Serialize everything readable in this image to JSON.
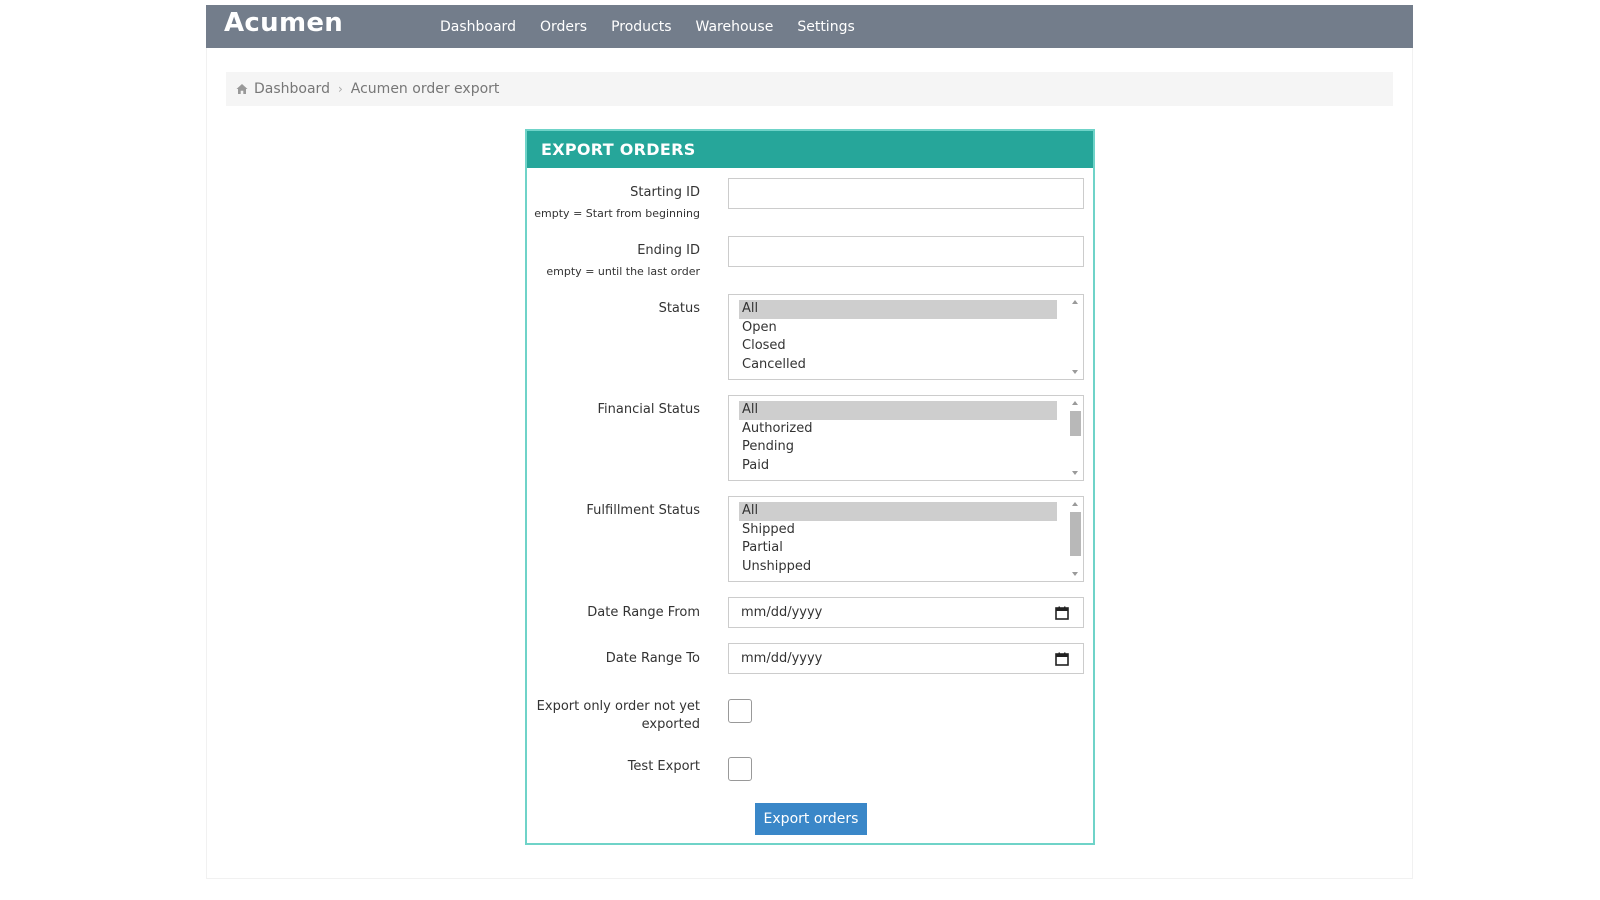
{
  "navbar": {
    "brand": "Acumen",
    "links": [
      {
        "label": "Dashboard"
      },
      {
        "label": "Orders"
      },
      {
        "label": "Products"
      },
      {
        "label": "Warehouse"
      },
      {
        "label": "Settings"
      }
    ]
  },
  "breadcrumb": {
    "home": "Dashboard",
    "current": "Acumen order export"
  },
  "form": {
    "title": "EXPORT ORDERS",
    "starting_id": {
      "label": "Starting ID",
      "hint": "empty = Start from beginning",
      "value": ""
    },
    "ending_id": {
      "label": "Ending ID",
      "hint": "empty = until the last order",
      "value": ""
    },
    "status": {
      "label": "Status",
      "options": [
        "All",
        "Open",
        "Closed",
        "Cancelled"
      ],
      "selected": "All"
    },
    "financial_status": {
      "label": "Financial Status",
      "options": [
        "All",
        "Authorized",
        "Pending",
        "Paid"
      ],
      "selected": "All"
    },
    "fulfillment_status": {
      "label": "Fulfillment Status",
      "options": [
        "All",
        "Shipped",
        "Partial",
        "Unshipped"
      ],
      "selected": "All"
    },
    "date_from": {
      "label": "Date Range From",
      "placeholder": "mm/dd/yyyy"
    },
    "date_to": {
      "label": "Date Range To",
      "placeholder": "mm/dd/yyyy"
    },
    "not_exported": {
      "label_line1": "Export only order not yet",
      "label_line2": "exported",
      "checked": false
    },
    "test_export": {
      "label": "Test Export",
      "checked": false
    },
    "submit_label": "Export orders"
  },
  "colors": {
    "navbar": "#737d8b",
    "panel_heading": "#26a69a",
    "panel_border": "#6fd3c8",
    "button": "#3a87c8"
  }
}
